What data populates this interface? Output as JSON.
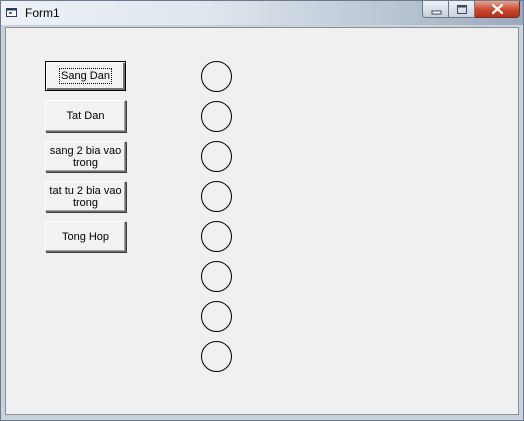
{
  "window": {
    "title": "Form1",
    "titlebar_icon": "form-window-icon",
    "controls": [
      "minimize-icon",
      "maximize-icon",
      "close-icon"
    ]
  },
  "form": {
    "buttons": [
      {
        "label": "Sang Dan"
      },
      {
        "label": "Tat Dan"
      },
      {
        "label": "sang 2 bia vao trong"
      },
      {
        "label": "tat tu 2 bia vao trong"
      },
      {
        "label": "Tong Hop"
      }
    ],
    "lamps": [
      {
        "state": "off"
      },
      {
        "state": "off"
      },
      {
        "state": "off"
      },
      {
        "state": "off"
      },
      {
        "state": "off"
      },
      {
        "state": "off"
      },
      {
        "state": "off"
      },
      {
        "state": "off"
      }
    ]
  }
}
